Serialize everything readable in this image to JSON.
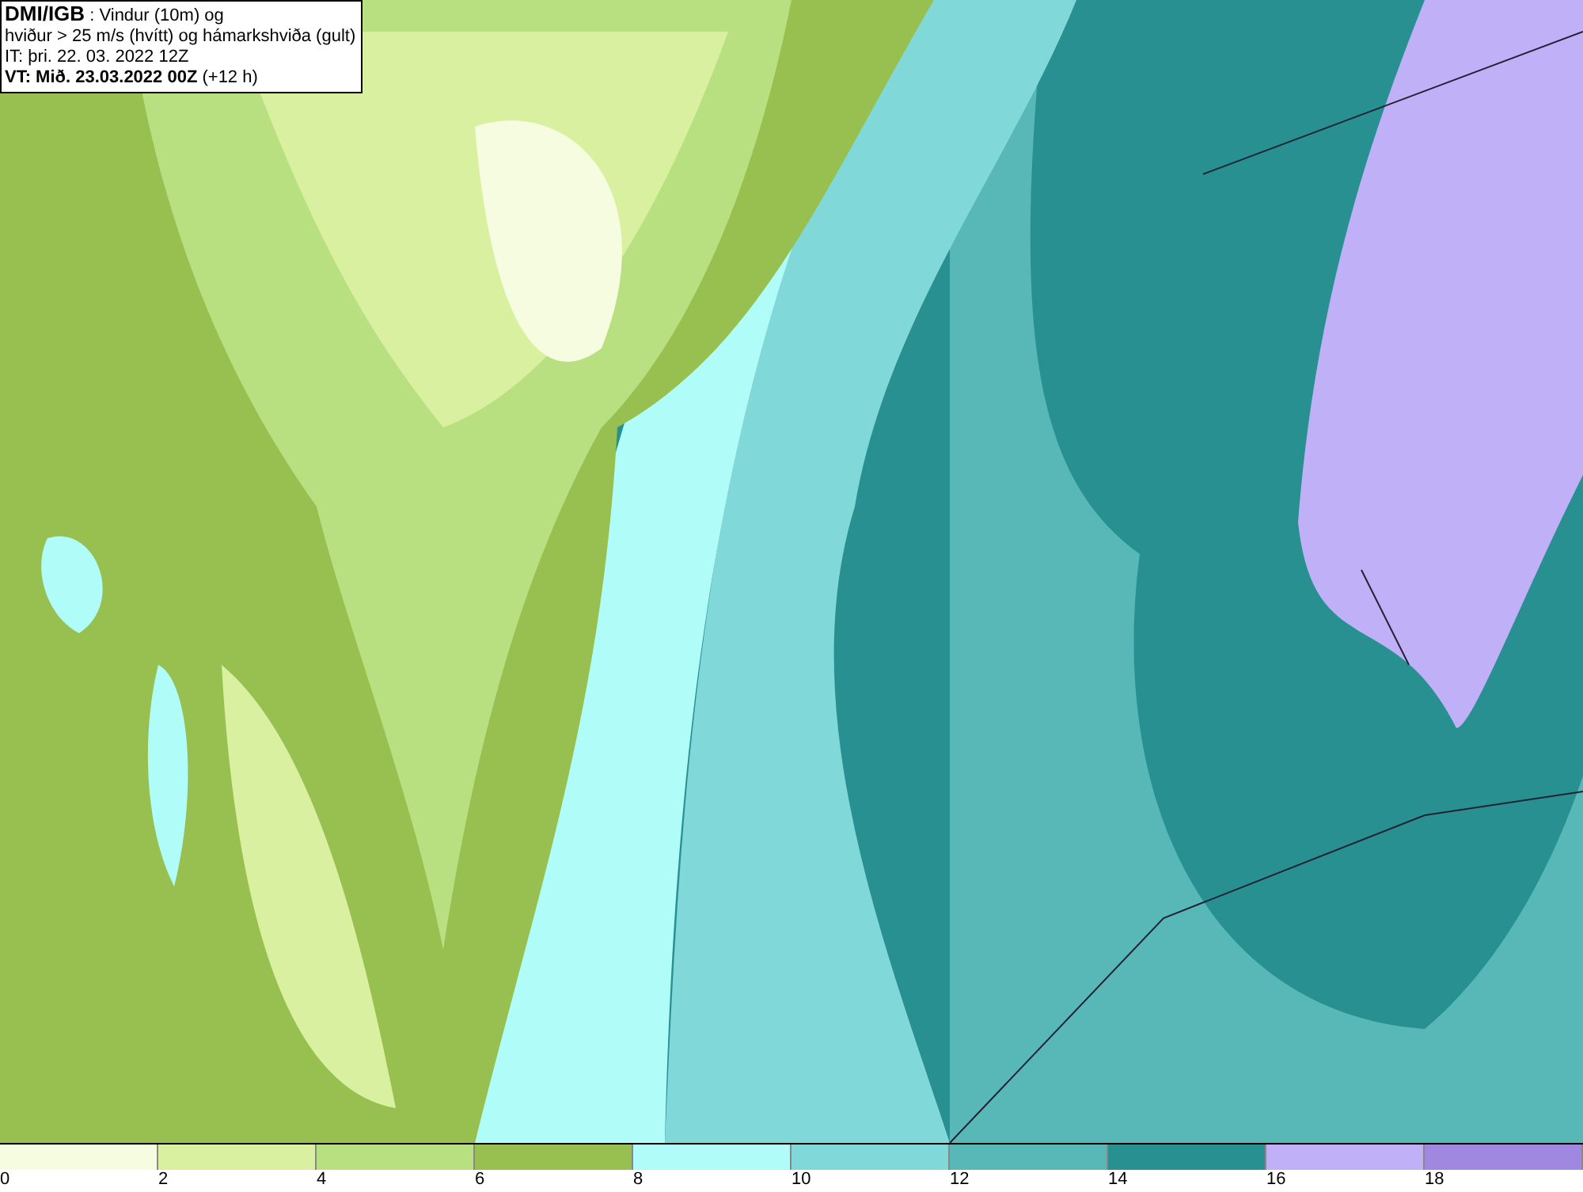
{
  "map": {
    "title_lines": [
      "**DMI/IGB** : Vindur (10m) og",
      "hviður > 25 m/s (hvítt) og hámarkshviða (gult)",
      "IT: þri. 22. 03. 2022 12Z",
      "**VT: Mið. 23.03.2022 00Z** (+12 h)"
    ]
  },
  "legend": [
    {
      "label": "0",
      "color": "#f5fce0"
    },
    {
      "label": "2",
      "color": "#d8f0a0"
    },
    {
      "label": "4",
      "color": "#b8e080"
    },
    {
      "label": "6",
      "color": "#98c050"
    },
    {
      "label": "8",
      "color": "#b0fcf8"
    },
    {
      "label": "10",
      "color": "#80d8d8"
    },
    {
      "label": "12",
      "color": "#58b8b8"
    },
    {
      "label": "14",
      "color": "#289090"
    },
    {
      "label": "16",
      "color": "#c0b0f8"
    },
    {
      "label": "18",
      "color": "#a088e0"
    }
  ]
}
